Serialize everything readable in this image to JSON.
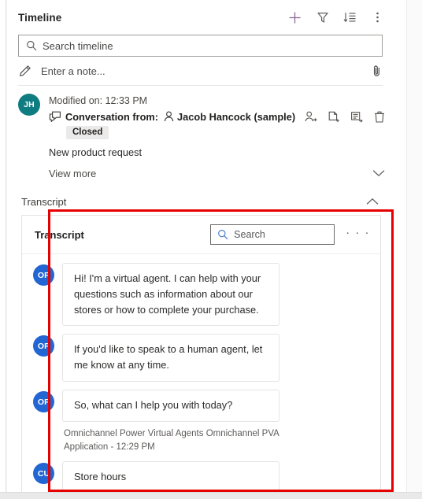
{
  "header": {
    "title": "Timeline",
    "actions": [
      {
        "name": "add-icon",
        "label": "Add"
      },
      {
        "name": "filter-icon",
        "label": "Filter"
      },
      {
        "name": "sort-icon",
        "label": "Sort"
      },
      {
        "name": "more-commands-icon",
        "label": "More commands"
      }
    ]
  },
  "search": {
    "placeholder": "Search timeline",
    "icon": "search-icon"
  },
  "note": {
    "placeholder": "Enter a note...",
    "pencil_icon": "pencil-icon",
    "attach_icon": "paperclip-icon"
  },
  "record": {
    "avatar_initials": "JH",
    "avatar_color": "#0f7c81",
    "modified_on": "Modified on: 12:33 PM",
    "conversation_label": "Conversation from:",
    "person": "Jacob Hancock (sample)",
    "status_badge": "Closed",
    "subject": "New product request",
    "view_more": "View more",
    "actions": [
      {
        "name": "assign-user-icon",
        "label": "Assign"
      },
      {
        "name": "convert-to-case-icon",
        "label": "Convert to case"
      },
      {
        "name": "add-note-icon",
        "label": "Add note"
      },
      {
        "name": "delete-icon",
        "label": "Delete"
      }
    ]
  },
  "transcript_section": {
    "header_label": "Transcript",
    "collapse_icon": "chevron-up-icon",
    "card_title": "Transcript",
    "search_placeholder": "Search",
    "search_icon": "search-icon",
    "more_icon": "ellipsis-icon",
    "more_glyph": "· · ·",
    "messages": [
      {
        "avatar": "OP",
        "avatar_color": "#2266d3",
        "text": "Hi! I'm a virtual agent. I can help with your questions such as information about our stores or how to complete your purchase.",
        "meta": ""
      },
      {
        "avatar": "OP",
        "avatar_color": "#2266d3",
        "text": "If you'd like to speak to a human agent, let me know at any time.",
        "meta": ""
      },
      {
        "avatar": "OP",
        "avatar_color": "#2266d3",
        "text": "So, what can I help you with today?",
        "meta": "Omnichannel Power Virtual Agents Omnichannel PVA Application - 12:29 PM"
      },
      {
        "avatar": "CU",
        "avatar_color": "#2266d3",
        "text": "Store hours",
        "meta": ""
      }
    ]
  },
  "annotation": {
    "color": "#e60000",
    "name": "transcript-highlight-box"
  }
}
